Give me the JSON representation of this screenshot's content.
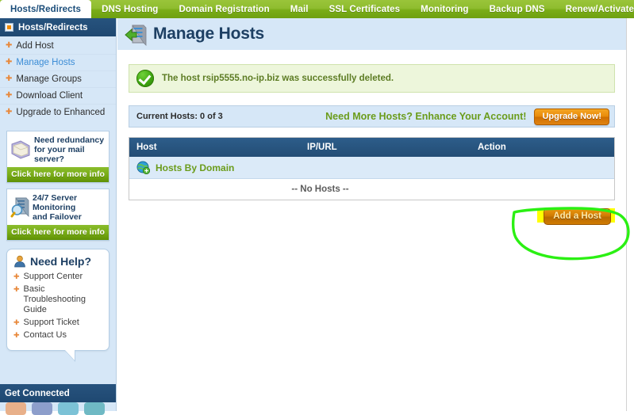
{
  "tabs": [
    {
      "label": "Hosts/Redirects",
      "active": true
    },
    {
      "label": "DNS Hosting",
      "active": false
    },
    {
      "label": "Domain Registration",
      "active": false
    },
    {
      "label": "Mail",
      "active": false
    },
    {
      "label": "SSL Certificates",
      "active": false
    },
    {
      "label": "Monitoring",
      "active": false
    },
    {
      "label": "Backup DNS",
      "active": false
    },
    {
      "label": "Renew/Activate",
      "active": false
    }
  ],
  "sidebar": {
    "header": "Hosts/Redirects",
    "items": [
      {
        "label": "Add Host",
        "selected": false
      },
      {
        "label": "Manage Hosts",
        "selected": true
      },
      {
        "label": "Manage Groups",
        "selected": false
      },
      {
        "label": "Download Client",
        "selected": false
      },
      {
        "label": "Upgrade to Enhanced",
        "selected": false
      }
    ],
    "promos": [
      {
        "line1": "Need redundancy",
        "line2": "for your mail server?",
        "cta": "Click here for more info"
      },
      {
        "line1": "24/7 Server Monitoring",
        "line2": "and Failover",
        "cta": "Click here for more info"
      }
    ],
    "help": {
      "title": "Need Help?",
      "links": [
        "Support Center",
        "Basic Troubleshooting Guide",
        "Support Ticket",
        "Contact Us"
      ]
    },
    "get_connected": "Get Connected"
  },
  "main": {
    "page_title": "Manage Hosts",
    "alert": "The host rsip5555.no-ip.biz was successfully deleted.",
    "host_count": "Current Hosts: 0 of 3",
    "enhance_text": "Need More Hosts? Enhance Your Account!",
    "upgrade_button": "Upgrade Now!",
    "table": {
      "columns": [
        "Host",
        "IP/URL",
        "Action"
      ],
      "group_row": "Hosts By Domain",
      "empty_text": "-- No Hosts --"
    },
    "add_host_button": "Add a Host"
  },
  "colors": {
    "tabbar_green": "#8fbd2f",
    "sidebar_blue": "#d6e7f7",
    "header_navy": "#23496f",
    "accent_orange": "#e8883a",
    "link_green": "#6b9c1b",
    "annotation_green": "#2bf013",
    "highlight_yellow": "#ffff00"
  }
}
